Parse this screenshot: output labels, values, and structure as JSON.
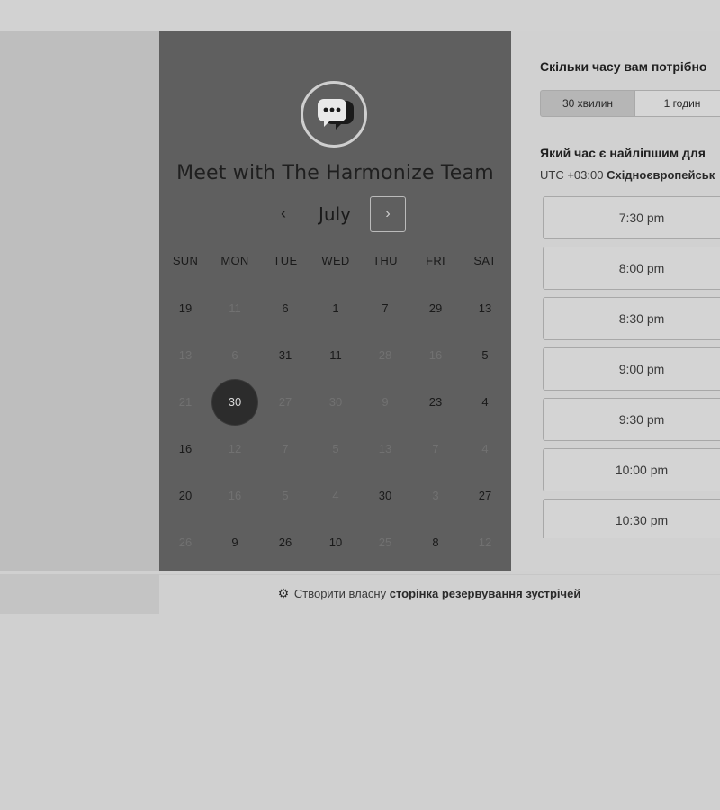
{
  "calendar": {
    "title": "Meet with The Harmonize Team",
    "avatar_icon": "chat-bubble-icon",
    "month": "July",
    "prev_icon": "chevron-left-icon",
    "next_icon": "chevron-right-icon",
    "prev_glyph": "‹",
    "next_glyph": "›",
    "weekdays": [
      "SUN",
      "MON",
      "TUE",
      "WED",
      "THU",
      "FRI",
      "SAT"
    ],
    "weeks": [
      [
        {
          "day": "19",
          "available": true
        },
        {
          "day": "11",
          "available": false
        },
        {
          "day": "6",
          "available": true
        },
        {
          "day": "1",
          "available": true
        },
        {
          "day": "7",
          "available": true
        },
        {
          "day": "29",
          "available": true
        },
        {
          "day": "13",
          "available": true
        }
      ],
      [
        {
          "day": "13",
          "available": false
        },
        {
          "day": "6",
          "available": false
        },
        {
          "day": "31",
          "available": true
        },
        {
          "day": "11",
          "available": true
        },
        {
          "day": "28",
          "available": false
        },
        {
          "day": "16",
          "available": false
        },
        {
          "day": "5",
          "available": true
        }
      ],
      [
        {
          "day": "21",
          "available": false
        },
        {
          "day": "30",
          "available": true,
          "selected": true
        },
        {
          "day": "27",
          "available": false
        },
        {
          "day": "30",
          "available": false
        },
        {
          "day": "9",
          "available": false
        },
        {
          "day": "23",
          "available": true
        },
        {
          "day": "4",
          "available": true
        }
      ],
      [
        {
          "day": "16",
          "available": true
        },
        {
          "day": "12",
          "available": false
        },
        {
          "day": "7",
          "available": false
        },
        {
          "day": "5",
          "available": false
        },
        {
          "day": "13",
          "available": false
        },
        {
          "day": "7",
          "available": false
        },
        {
          "day": "4",
          "available": false
        }
      ],
      [
        {
          "day": "20",
          "available": true
        },
        {
          "day": "16",
          "available": false
        },
        {
          "day": "5",
          "available": false
        },
        {
          "day": "4",
          "available": false
        },
        {
          "day": "30",
          "available": true
        },
        {
          "day": "3",
          "available": false
        },
        {
          "day": "27",
          "available": true
        }
      ],
      [
        {
          "day": "26",
          "available": false
        },
        {
          "day": "9",
          "available": true
        },
        {
          "day": "26",
          "available": true
        },
        {
          "day": "10",
          "available": true
        },
        {
          "day": "25",
          "available": false
        },
        {
          "day": "8",
          "available": true
        },
        {
          "day": "12",
          "available": false
        }
      ]
    ]
  },
  "booking": {
    "duration_question": "Скільки часу вам потрібно",
    "durations": [
      {
        "label": "30 хвилин",
        "active": true
      },
      {
        "label": "1 годин",
        "active": false
      }
    ],
    "time_question": "Який час є найліпшим для",
    "timezone_offset": "UTC +03:00",
    "timezone_name": "Східноєвропейськ",
    "slots": [
      "7:30 pm",
      "8:00 pm",
      "8:30 pm",
      "9:00 pm",
      "9:30 pm",
      "10:00 pm",
      "10:30 pm"
    ]
  },
  "footer": {
    "icon": "hubspot-sprocket-icon",
    "icon_glyph": "⚙",
    "text_prefix": "Створити власну",
    "text_bold": "сторінка резервування зустрічей"
  }
}
